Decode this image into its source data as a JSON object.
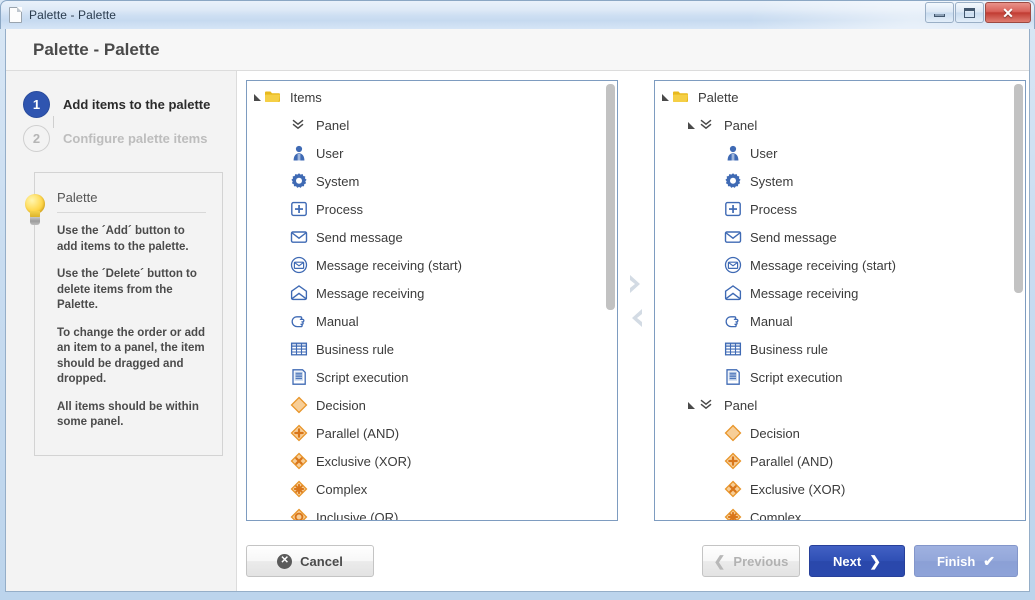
{
  "window": {
    "title": "Palette - Palette",
    "icon": "document-icon",
    "controls": {
      "minimize": "minimize-icon",
      "maximize": "maximize-icon",
      "close": "✕"
    }
  },
  "header": {
    "title": "Palette - Palette"
  },
  "sidebar": {
    "steps": [
      {
        "number": "1",
        "label": "Add items to the palette",
        "state": "active"
      },
      {
        "number": "2",
        "label": "Configure palette items",
        "state": "inactive"
      }
    ],
    "hint": {
      "icon": "lightbulb-icon",
      "title": "Palette",
      "paragraphs": [
        "Use the ´Add´ button to add items to the palette.",
        "Use the ´Delete´ button to delete items from the Palette.",
        "To change the order or add an item to a panel, the item should be dragged and dropped.",
        "All items should be within some panel."
      ]
    }
  },
  "trees": {
    "left": {
      "name": "items-tree",
      "rows": [
        {
          "label": "Items",
          "icon": "folder-icon",
          "indent": 0,
          "twisty": "open"
        },
        {
          "label": "Panel",
          "icon": "panel-chevrons-icon",
          "indent": 1,
          "twisty": "none"
        },
        {
          "label": "User",
          "icon": "user-icon",
          "indent": 1,
          "twisty": "none"
        },
        {
          "label": "System",
          "icon": "gear-icon",
          "indent": 1,
          "twisty": "none"
        },
        {
          "label": "Process",
          "icon": "process-plus-icon",
          "indent": 1,
          "twisty": "none"
        },
        {
          "label": "Send message",
          "icon": "envelope-icon",
          "indent": 1,
          "twisty": "none"
        },
        {
          "label": "Message receiving (start)",
          "icon": "envelope-circle-icon",
          "indent": 1,
          "twisty": "none"
        },
        {
          "label": "Message receiving",
          "icon": "envelope-open-icon",
          "indent": 1,
          "twisty": "none"
        },
        {
          "label": "Manual",
          "icon": "hand-icon",
          "indent": 1,
          "twisty": "none"
        },
        {
          "label": "Business rule",
          "icon": "table-grid-icon",
          "indent": 1,
          "twisty": "none"
        },
        {
          "label": "Script execution",
          "icon": "script-icon",
          "indent": 1,
          "twisty": "none"
        },
        {
          "label": "Decision",
          "icon": "diamond-icon",
          "indent": 1,
          "twisty": "none"
        },
        {
          "label": "Parallel (AND)",
          "icon": "diamond-plus-icon",
          "indent": 1,
          "twisty": "none"
        },
        {
          "label": "Exclusive (XOR)",
          "icon": "diamond-x-icon",
          "indent": 1,
          "twisty": "none"
        },
        {
          "label": "Complex",
          "icon": "diamond-asterisk-icon",
          "indent": 1,
          "twisty": "none"
        },
        {
          "label": "Inclusive (OR)",
          "icon": "diamond-circle-icon",
          "indent": 1,
          "twisty": "none"
        }
      ],
      "scrollbar": {
        "thumb_top_pct": 0,
        "thumb_height_pct": 52
      }
    },
    "right": {
      "name": "palette-tree",
      "rows": [
        {
          "label": "Palette",
          "icon": "folder-icon",
          "indent": 0,
          "twisty": "open"
        },
        {
          "label": "Panel",
          "icon": "panel-chevrons-icon",
          "indent": 1,
          "twisty": "open"
        },
        {
          "label": "User",
          "icon": "user-icon",
          "indent": 2,
          "twisty": "none"
        },
        {
          "label": "System",
          "icon": "gear-icon",
          "indent": 2,
          "twisty": "none"
        },
        {
          "label": "Process",
          "icon": "process-plus-icon",
          "indent": 2,
          "twisty": "none"
        },
        {
          "label": "Send message",
          "icon": "envelope-icon",
          "indent": 2,
          "twisty": "none"
        },
        {
          "label": "Message receiving (start)",
          "icon": "envelope-circle-icon",
          "indent": 2,
          "twisty": "none"
        },
        {
          "label": "Message receiving",
          "icon": "envelope-open-icon",
          "indent": 2,
          "twisty": "none"
        },
        {
          "label": "Manual",
          "icon": "hand-icon",
          "indent": 2,
          "twisty": "none"
        },
        {
          "label": "Business rule",
          "icon": "table-grid-icon",
          "indent": 2,
          "twisty": "none"
        },
        {
          "label": "Script execution",
          "icon": "script-icon",
          "indent": 2,
          "twisty": "none"
        },
        {
          "label": "Panel",
          "icon": "panel-chevrons-icon",
          "indent": 1,
          "twisty": "open"
        },
        {
          "label": "Decision",
          "icon": "diamond-icon",
          "indent": 2,
          "twisty": "none"
        },
        {
          "label": "Parallel (AND)",
          "icon": "diamond-plus-icon",
          "indent": 2,
          "twisty": "none"
        },
        {
          "label": "Exclusive (XOR)",
          "icon": "diamond-x-icon",
          "indent": 2,
          "twisty": "none"
        },
        {
          "label": "Complex",
          "icon": "diamond-asterisk-icon",
          "indent": 2,
          "twisty": "none"
        }
      ],
      "scrollbar": {
        "thumb_top_pct": 0,
        "thumb_height_pct": 48
      }
    }
  },
  "transfer": {
    "add": "chevron-right-icon",
    "remove": "chevron-left-icon"
  },
  "footer": {
    "cancel": "Cancel",
    "previous": "Previous",
    "next": "Next",
    "finish": "Finish"
  },
  "colors": {
    "accent_blue": "#2f4fb5",
    "finish_blue": "#8ea3d8",
    "folder_yellow": "#e8b91d",
    "icon_blue": "#3f6ab4",
    "icon_orange": "#e8952a",
    "panel_border": "#7e9cc0"
  }
}
